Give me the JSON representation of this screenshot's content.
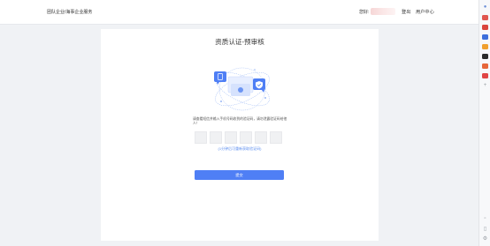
{
  "header": {
    "title": "团队企业/海事企业服务",
    "account_label": "您好: ",
    "logout": "登出",
    "user_center": "用户中心"
  },
  "page": {
    "title": "资质认证-预审核",
    "hint": "请查看短信并输入手机号码收到的验证码，请勿泄露验证码给他人！",
    "code_length": 6,
    "resend_link": "(1分钟后可重新获取验证码)",
    "submit": "提交"
  },
  "colors": {
    "accent": "#4f7ff5",
    "link": "#5b8def"
  },
  "sidebar_right": {
    "icons": [
      "bell-icon",
      "app-icon",
      "mail-icon",
      "image-icon",
      "calendar-icon",
      "tool-icon",
      "app-icon",
      "app-icon",
      "plus-icon",
      "grid-icon",
      "panel-icon",
      "settings-icon"
    ]
  }
}
